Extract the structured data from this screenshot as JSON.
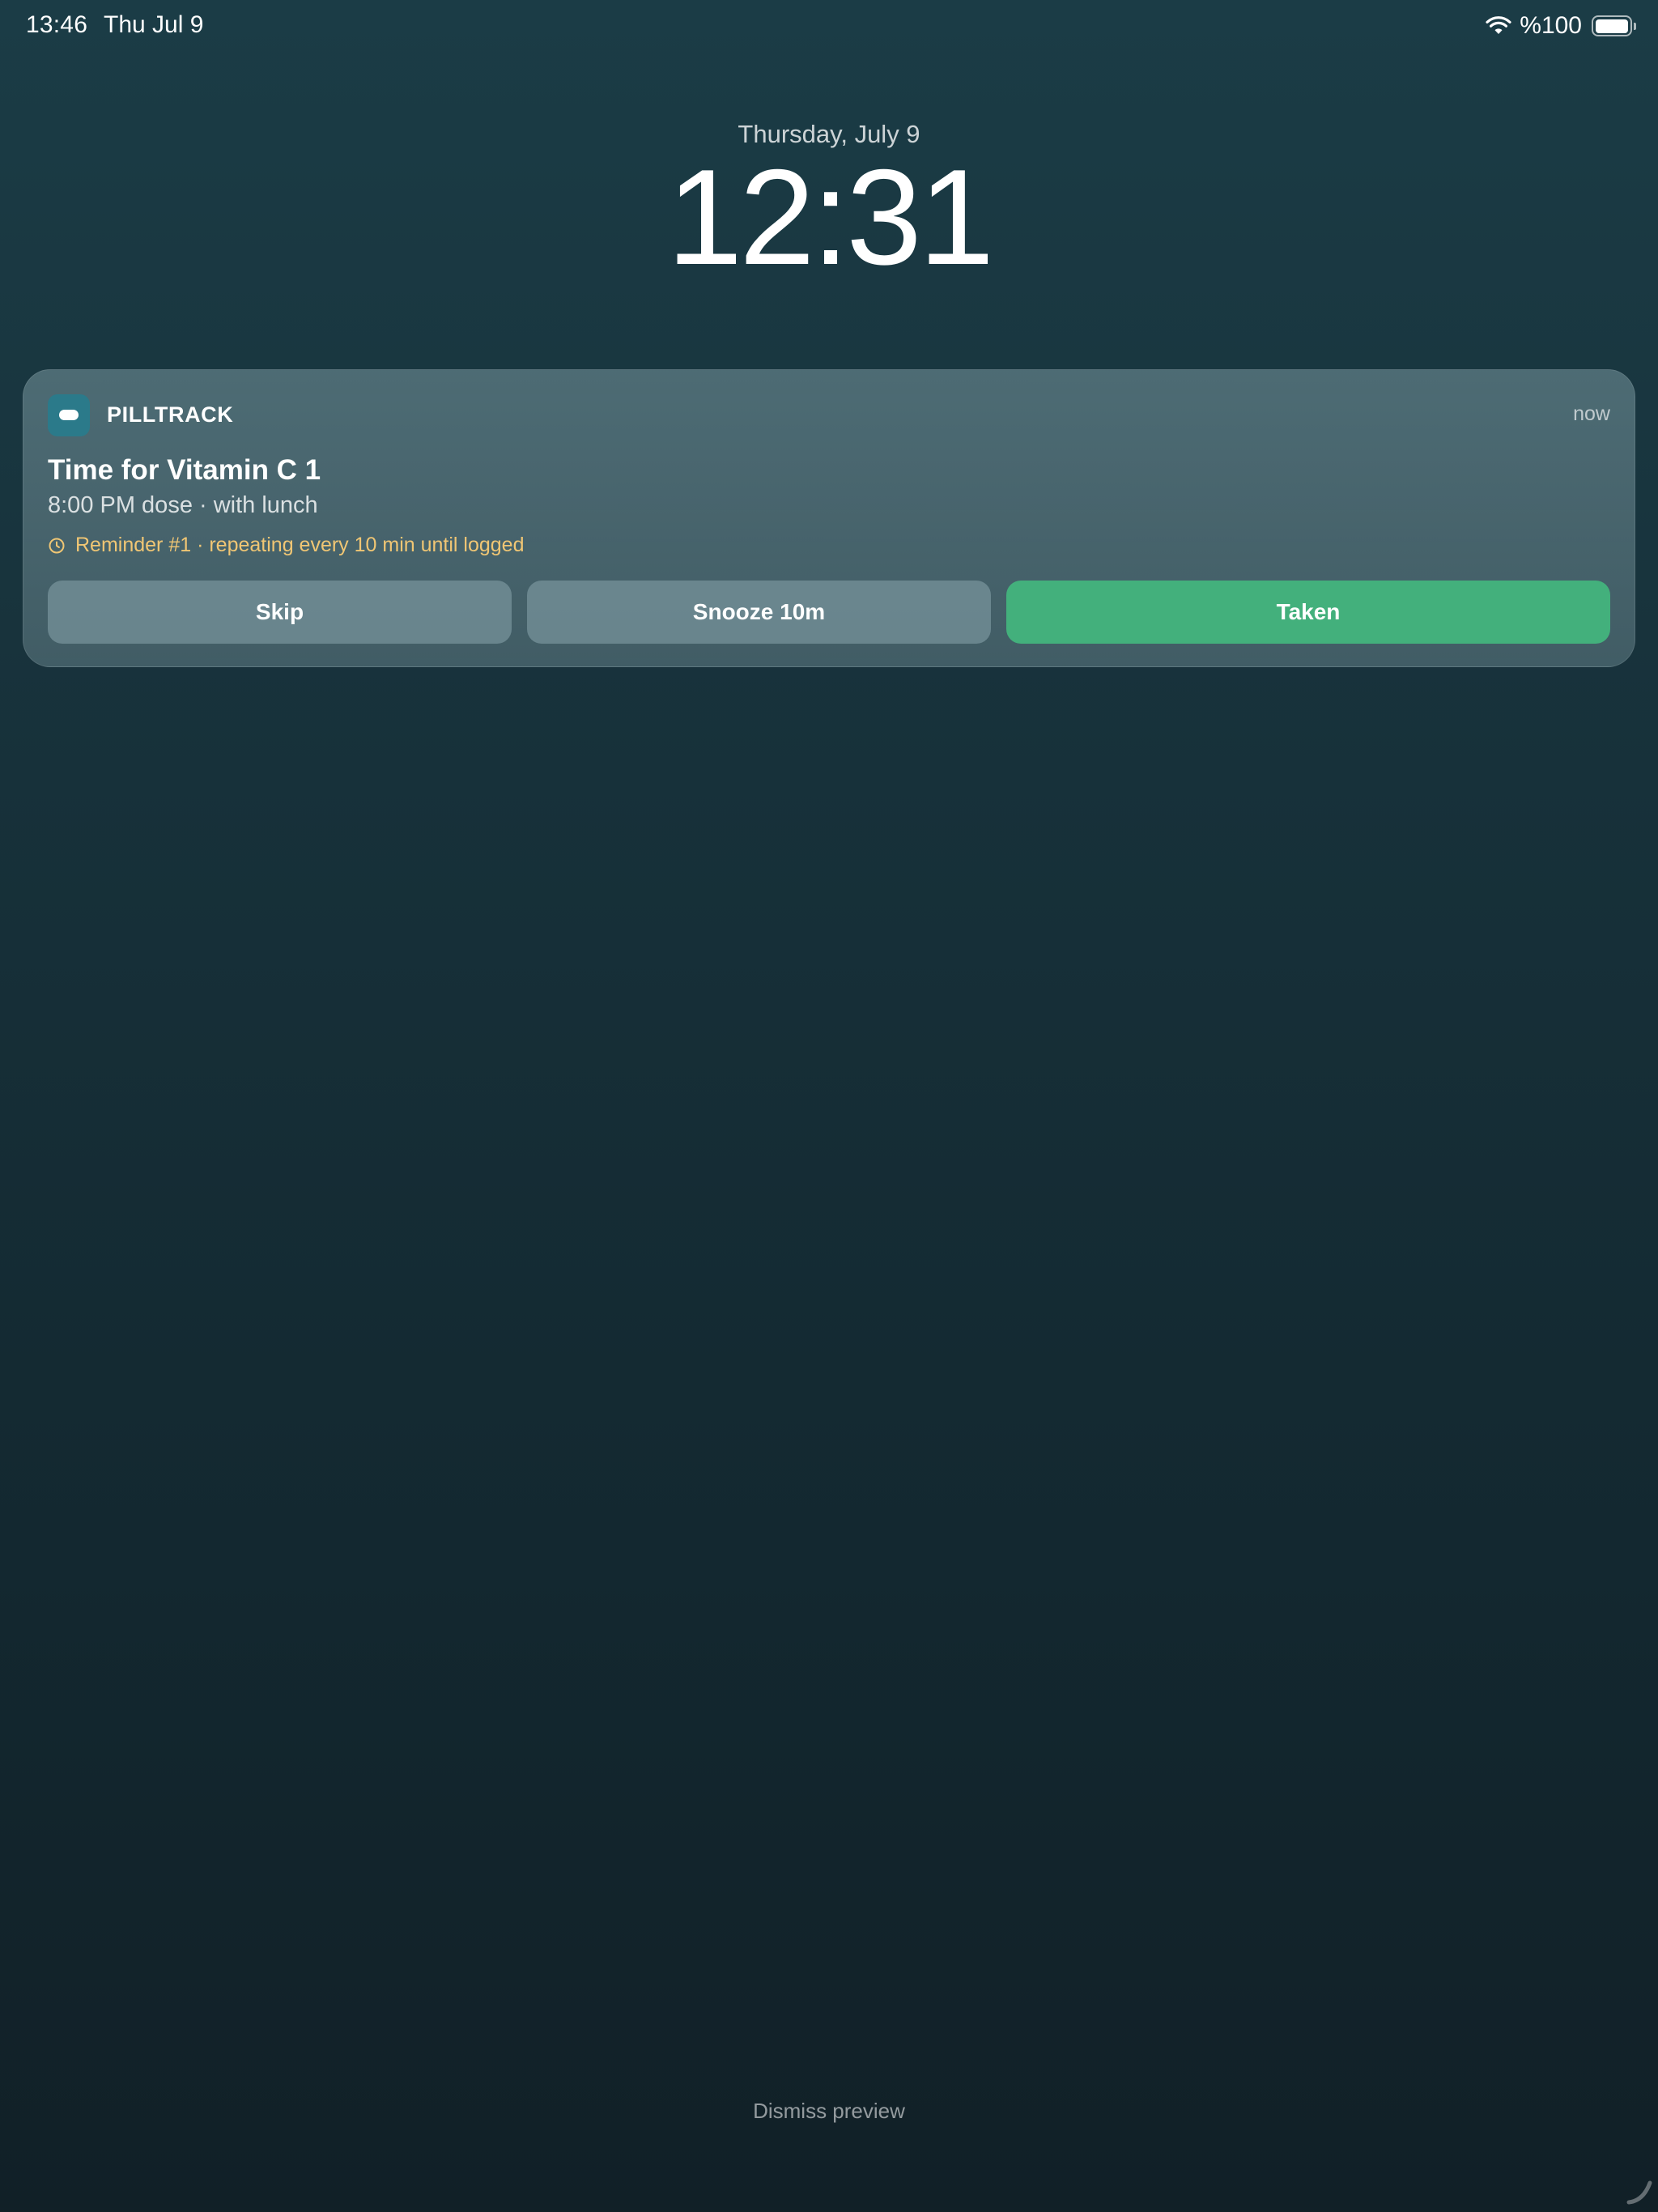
{
  "status_bar": {
    "time": "13:46",
    "date": "Thu Jul 9",
    "battery_percent": "%100",
    "wifi_icon": "wifi-icon",
    "battery_icon": "battery-icon",
    "battery_level": 1.0
  },
  "lock_screen": {
    "date": "Thursday, July 9",
    "time": "12:31"
  },
  "notification": {
    "app_icon": "pill-icon",
    "app_name": "PILLTRACK",
    "timestamp": "now",
    "title": "Time for Vitamin C 1",
    "subtitle": "8:00 PM dose · with lunch",
    "reminder_icon": "clock-icon",
    "reminder": "Reminder #1 · repeating every 10 min until logged",
    "actions": {
      "skip": "Skip",
      "snooze": "Snooze 10m",
      "taken": "Taken"
    }
  },
  "footer": {
    "dismiss_label": "Dismiss preview"
  },
  "colors": {
    "accent": "#43b07c",
    "reminder": "#f0c674",
    "app_icon_bg": "#2b7a8a"
  }
}
